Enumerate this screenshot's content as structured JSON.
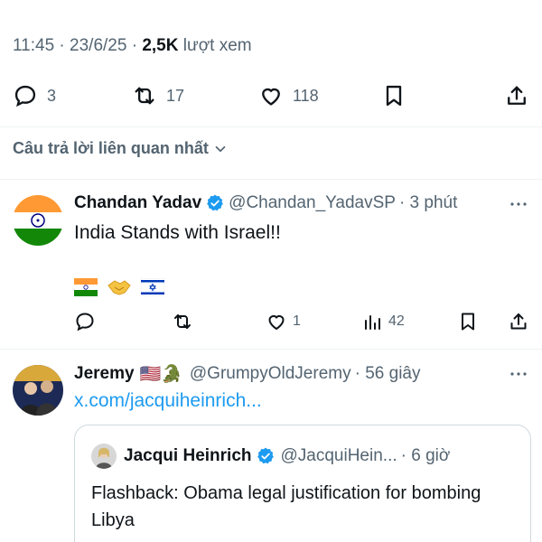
{
  "meta": {
    "time": "11:45",
    "date": "23/6/25",
    "sep": "·",
    "views_count": "2,5K",
    "views_label": "lượt xem"
  },
  "stats": {
    "replies": "3",
    "reposts": "17",
    "likes": "118"
  },
  "sort": {
    "label": "Câu trả lời liên quan nhất"
  },
  "tweets": [
    {
      "name": "Chandan Yadav",
      "handle": "@Chandan_YadavSP",
      "time": "· 3 phút",
      "text": "India Stands with Israel!!",
      "flags": [
        "india-flag",
        "handshake",
        "israel-flag"
      ],
      "replies": "",
      "reposts": "",
      "likes": "1",
      "views": "42"
    },
    {
      "name": "Jeremy",
      "name_emoji": "🇺🇸🐊",
      "handle": "@GrumpyOldJeremy",
      "time": "· 56 giây",
      "link": "x.com/jacquiheinrich...",
      "quote": {
        "name": "Jacqui Heinrich",
        "handle": "@JacquiHein...",
        "time": "· 6 giờ",
        "text": "Flashback: Obama legal justification for bombing Libya"
      }
    }
  ],
  "colors": {
    "text": "#0f1419",
    "secondary": "#536471",
    "link": "#1d9bf0",
    "verified": "#1d9bf0",
    "divider": "#eff3f4"
  }
}
